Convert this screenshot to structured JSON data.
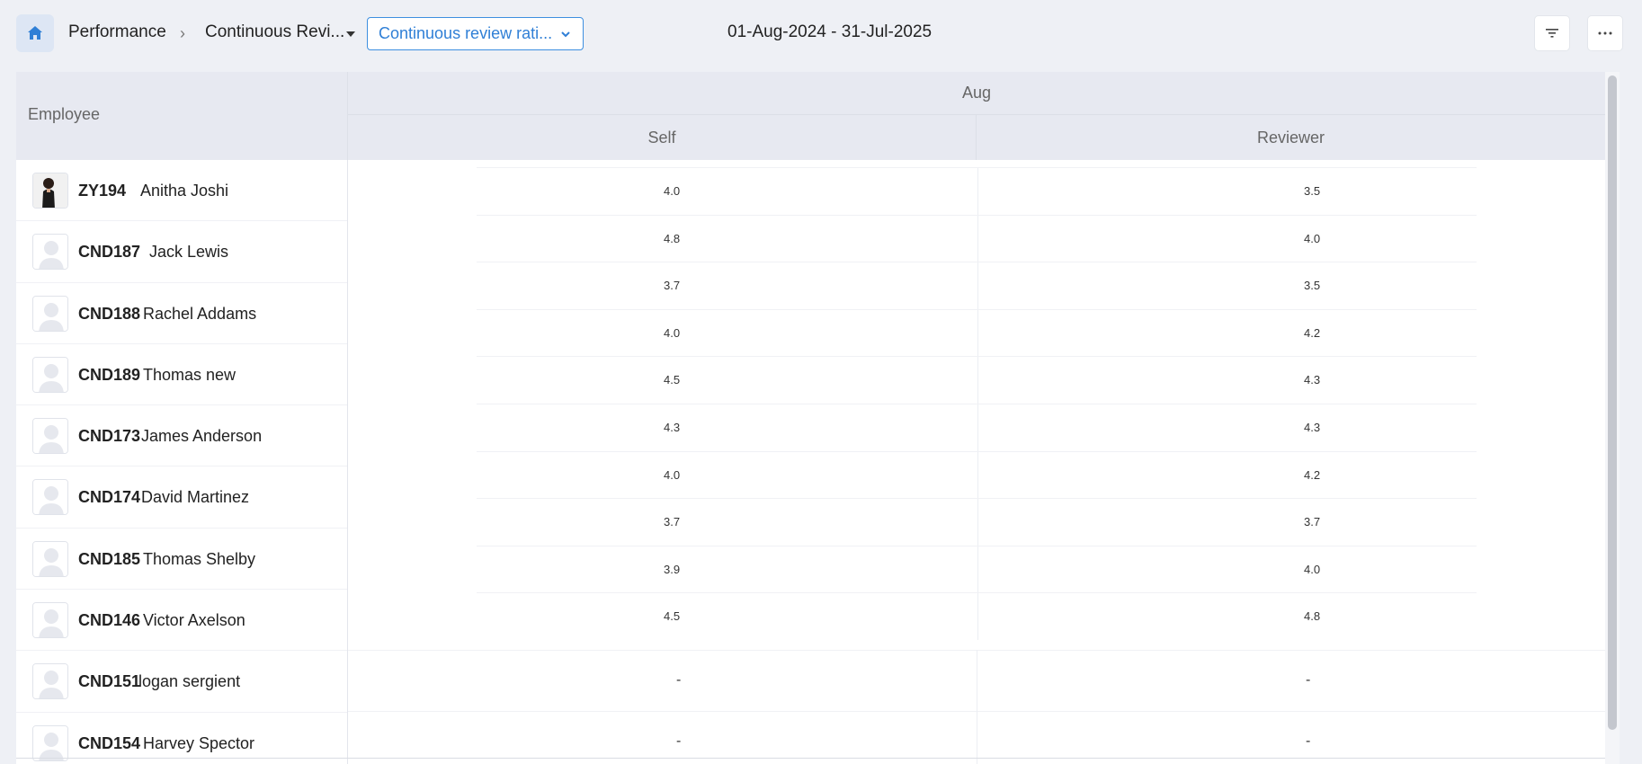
{
  "breadcrumb": {
    "home_icon": "home-icon",
    "module": "Performance",
    "separator": "›",
    "section": "Continuous Revi..."
  },
  "view_select": {
    "value": "Continuous review rati...",
    "icon": "chevron-down-icon"
  },
  "date_range": "01-Aug-2024 - 31-Jul-2025",
  "toolbar": {
    "filter_icon": "filter-icon",
    "more_icon": "more-icon"
  },
  "table": {
    "employee_header": "Employee",
    "month_header": "Aug",
    "self_header": "Self",
    "reviewer_header": "Reviewer",
    "employees": [
      {
        "id": "ZY194",
        "name": "Anitha Joshi",
        "photo": true
      },
      {
        "id": "CND187",
        "name": "Jack Lewis",
        "photo": false
      },
      {
        "id": "CND188",
        "name": "Rachel Addams",
        "photo": false
      },
      {
        "id": "CND189",
        "name": "Thomas new",
        "photo": false
      },
      {
        "id": "CND173",
        "name": "James Anderson",
        "photo": false
      },
      {
        "id": "CND174",
        "name": "David Martinez",
        "photo": false
      },
      {
        "id": "CND185",
        "name": "Thomas Shelby",
        "photo": false
      },
      {
        "id": "CND146",
        "name": "Victor Axelson",
        "photo": false
      },
      {
        "id": "CND151",
        "name": "logan sergient",
        "photo": false
      },
      {
        "id": "CND154",
        "name": "Harvey Spector",
        "photo": false
      }
    ],
    "ratings": [
      {
        "self": "4.0",
        "reviewer": "3.5"
      },
      {
        "self": "4.8",
        "reviewer": "4.0"
      },
      {
        "self": "3.7",
        "reviewer": "3.5"
      },
      {
        "self": "4.0",
        "reviewer": "4.2"
      },
      {
        "self": "4.5",
        "reviewer": "4.3"
      },
      {
        "self": "4.3",
        "reviewer": "4.3"
      },
      {
        "self": "4.0",
        "reviewer": "4.2"
      },
      {
        "self": "3.7",
        "reviewer": "3.7"
      },
      {
        "self": "3.9",
        "reviewer": "4.0"
      },
      {
        "self": "4.5",
        "reviewer": "4.8"
      }
    ],
    "empty_rows": [
      {
        "self": "-",
        "reviewer": "-"
      },
      {
        "self": "-",
        "reviewer": "-"
      }
    ]
  }
}
